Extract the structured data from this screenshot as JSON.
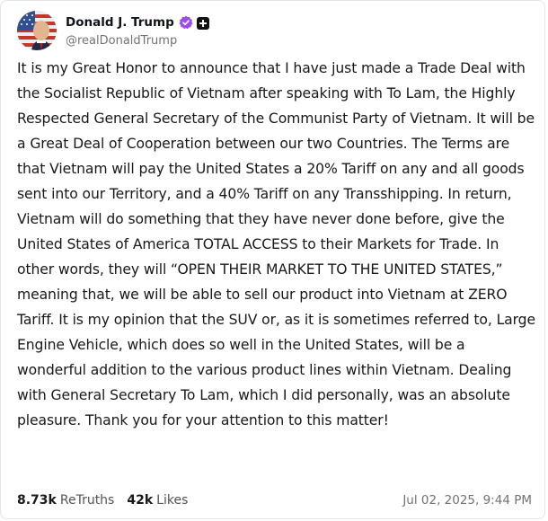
{
  "author": {
    "display_name": "Donald J. Trump",
    "handle": "@realDonaldTrump",
    "avatar_icon": "profile-avatar-flag",
    "verified_icon": "verified-badge-icon",
    "plus_icon": "plus-badge-icon",
    "verified_color": "#9a4cf0"
  },
  "post": {
    "text": "It is my Great Honor to announce that I have just made a Trade Deal with the Socialist Republic of Vietnam after speaking with To Lam, the Highly Respected General Secretary of the Communist Party of Vietnam. It will be a Great Deal of Cooperation between our two Countries. The Terms are that Vietnam will pay the United States a 20% Tariff on any and all goods sent into our Territory, and a 40% Tariff on any Transshipping. In return, Vietnam will do something that they have never done before, give the United States of America TOTAL ACCESS to their Markets for Trade. In other words, they will “OPEN THEIR MARKET TO THE UNITED STATES,” meaning that, we will be able to sell our product into Vietnam at ZERO Tariff. It is my opinion that the SUV or, as it is sometimes referred to, Large Engine Vehicle, which does so well in the United States, will be a wonderful addition to the various product lines within Vietnam. Dealing with General Secretary To Lam, which I did personally, was an absolute pleasure. Thank you for your attention to this matter!"
  },
  "stats": {
    "retruths_count": "8.73k",
    "retruths_label": "ReTruths",
    "likes_count": "42k",
    "likes_label": "Likes"
  },
  "timestamp": "Jul 02, 2025, 9:44 PM"
}
